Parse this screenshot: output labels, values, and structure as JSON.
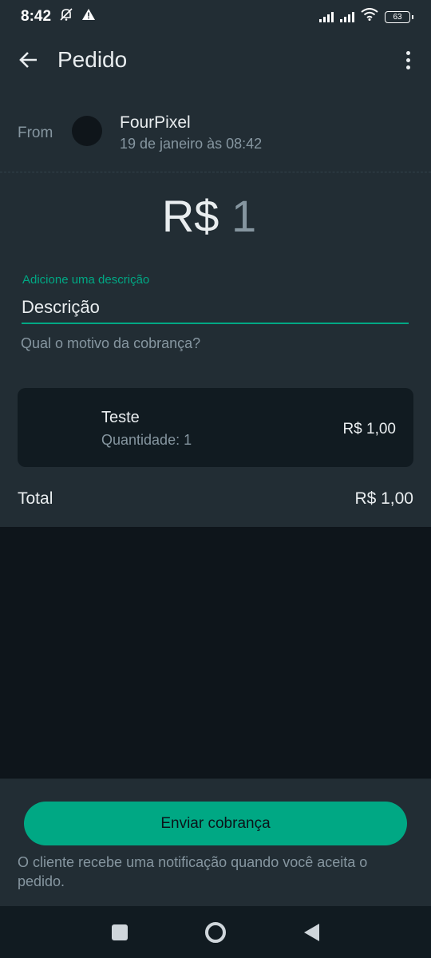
{
  "status_bar": {
    "time": "8:42",
    "battery": "63",
    "icons": [
      "bell-off-icon",
      "warning-icon",
      "signal-icon",
      "signal-icon",
      "wifi-icon",
      "battery-icon"
    ]
  },
  "app_bar": {
    "title": "Pedido",
    "back_icon": "arrow-left-icon",
    "more_icon": "more-vertical-icon"
  },
  "from": {
    "label": "From",
    "name": "FourPixel",
    "date": "19 de janeiro às 08:42"
  },
  "amount": {
    "currency": "R$",
    "value": "1"
  },
  "description": {
    "label": "Adicione uma descrição",
    "value": "Descrição",
    "helper": "Qual o motivo da cobrança?"
  },
  "item": {
    "name": "Teste",
    "quantity": "Quantidade: 1",
    "price": "R$ 1,00"
  },
  "total": {
    "label": "Total",
    "value": "R$ 1,00"
  },
  "footer": {
    "button_label": "Enviar cobrança",
    "note": "O cliente recebe uma notificação quando você aceita o pedido."
  },
  "colors": {
    "accent": "#00a884",
    "surface": "#222d34",
    "background": "#0e151b",
    "card": "#111b21"
  }
}
